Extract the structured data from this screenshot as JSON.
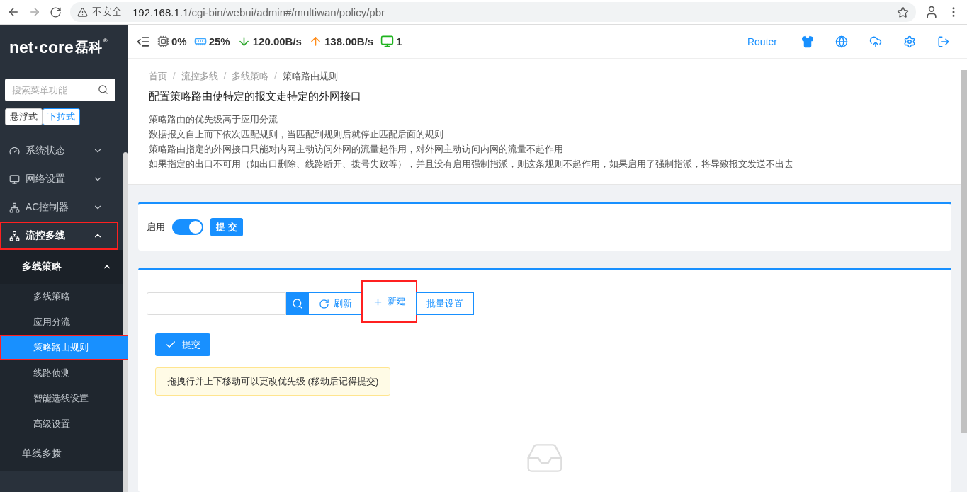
{
  "browser": {
    "security": "不安全",
    "url_host": "192.168.1.1",
    "url_path": "/cgi-bin/webui/admin#/multiwan/policy/pbr"
  },
  "sidebar": {
    "logo": "net·core",
    "logo_cn": "磊科",
    "logo_mark": "®",
    "search": {
      "placeholder": "搜索菜单功能"
    },
    "modes": [
      {
        "label": "悬浮式",
        "selected": false
      },
      {
        "label": "下拉式",
        "selected": true
      }
    ],
    "items": [
      {
        "label": "系统状态",
        "expanded": false,
        "annotated": false
      },
      {
        "label": "网络设置",
        "expanded": false,
        "annotated": false
      },
      {
        "label": "AC控制器",
        "expanded": false,
        "annotated": false
      },
      {
        "label": "流控多线",
        "expanded": true,
        "annotated": true,
        "children": [
          {
            "label": "多线策略",
            "expanded": true,
            "children": [
              {
                "label": "多线策略",
                "selected": false,
                "annotated": false
              },
              {
                "label": "应用分流",
                "selected": false,
                "annotated": false
              },
              {
                "label": "策略路由规则",
                "selected": true,
                "annotated": true
              },
              {
                "label": "线路侦测",
                "selected": false,
                "annotated": false
              },
              {
                "label": "智能选线设置",
                "selected": false,
                "annotated": false
              },
              {
                "label": "高级设置",
                "selected": false,
                "annotated": false
              }
            ]
          },
          {
            "label": "单线多拨"
          }
        ]
      }
    ]
  },
  "header": {
    "stats": [
      {
        "kind": "cpu",
        "value": "0%"
      },
      {
        "kind": "memory",
        "value": "25%"
      },
      {
        "kind": "download",
        "value": "120.00B/s"
      },
      {
        "kind": "upload",
        "value": "138.00B/s"
      },
      {
        "kind": "devices",
        "value": "1"
      }
    ],
    "mode": "Router"
  },
  "breadcrumb": {
    "separator": "/",
    "items": [
      {
        "label": "首页",
        "current": false
      },
      {
        "label": "流控多线",
        "current": false
      },
      {
        "label": "多线策略",
        "current": false
      },
      {
        "label": "策略路由规则",
        "current": true
      }
    ]
  },
  "title": "配置策略路由使特定的报文走特定的外网接口",
  "notes": [
    "策略路由的优先级高于应用分流",
    "数据报文自上而下依次匹配规则，当匹配到规则后就停止匹配后面的规则",
    "策略路由指定的外网接口只能对内网主动访问外网的流量起作用，对外网主动访问内网的流量不起作用",
    "如果指定的出口不可用（如出口删除、线路断开、拨号失败等），并且没有启用强制指派，则这条规则不起作用，如果启用了强制指派，将导致报文发送不出去"
  ],
  "enable": {
    "label": "启用",
    "on": true,
    "submit": "提 交"
  },
  "toolbar": {
    "buttons": [
      {
        "kind": "refresh",
        "label": "刷新",
        "annotated": false
      },
      {
        "kind": "add",
        "label": "新建",
        "annotated": true
      },
      {
        "kind": "plain",
        "label": "批量设置",
        "annotated": false
      }
    ],
    "submit": "提交",
    "tip": "拖拽行并上下移动可以更改优先级 (移动后记得提交)"
  }
}
